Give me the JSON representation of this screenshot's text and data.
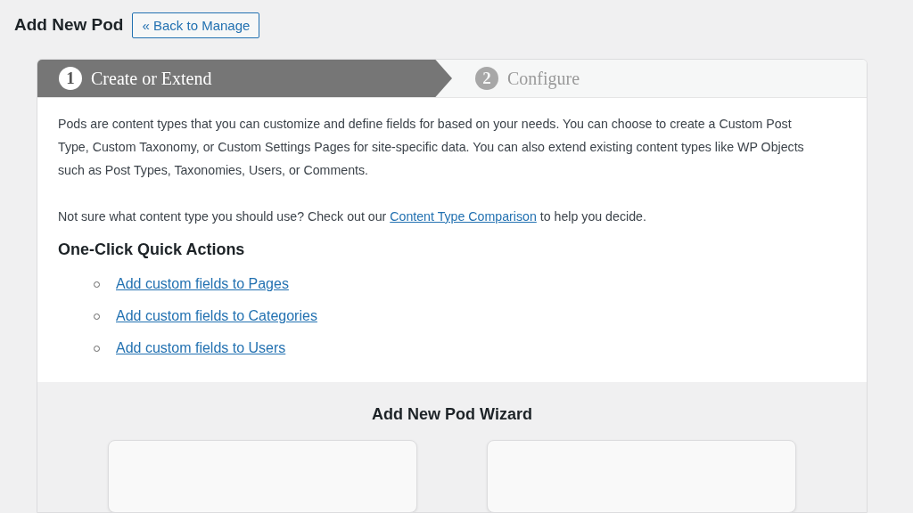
{
  "page": {
    "title": "Add New Pod",
    "back_button": "« Back to Manage"
  },
  "steps": [
    {
      "number": "1",
      "label": "Create or Extend",
      "selected": true
    },
    {
      "number": "2",
      "label": "Configure",
      "selected": false
    }
  ],
  "intro": "Pods are content types that you can customize and define fields for based on your needs. You can choose to create a Custom Post Type, Custom Taxonomy, or Custom Settings Pages for site-specific data. You can also extend existing content types like WP Objects such as Post Types, Taxonomies, Users, or Comments.",
  "note": {
    "before": "Not sure what content type you should use? Check out our ",
    "link": "Content Type Comparison",
    "after": " to help you decide."
  },
  "quick_actions": {
    "title": "One-Click Quick Actions",
    "items": [
      "Add custom fields to Pages",
      "Add custom fields to Categories",
      "Add custom fields to Users"
    ]
  },
  "wizard": {
    "title": "Add New Pod Wizard",
    "cards": [
      {
        "kind": "option"
      },
      {
        "kind": "option"
      }
    ]
  }
}
